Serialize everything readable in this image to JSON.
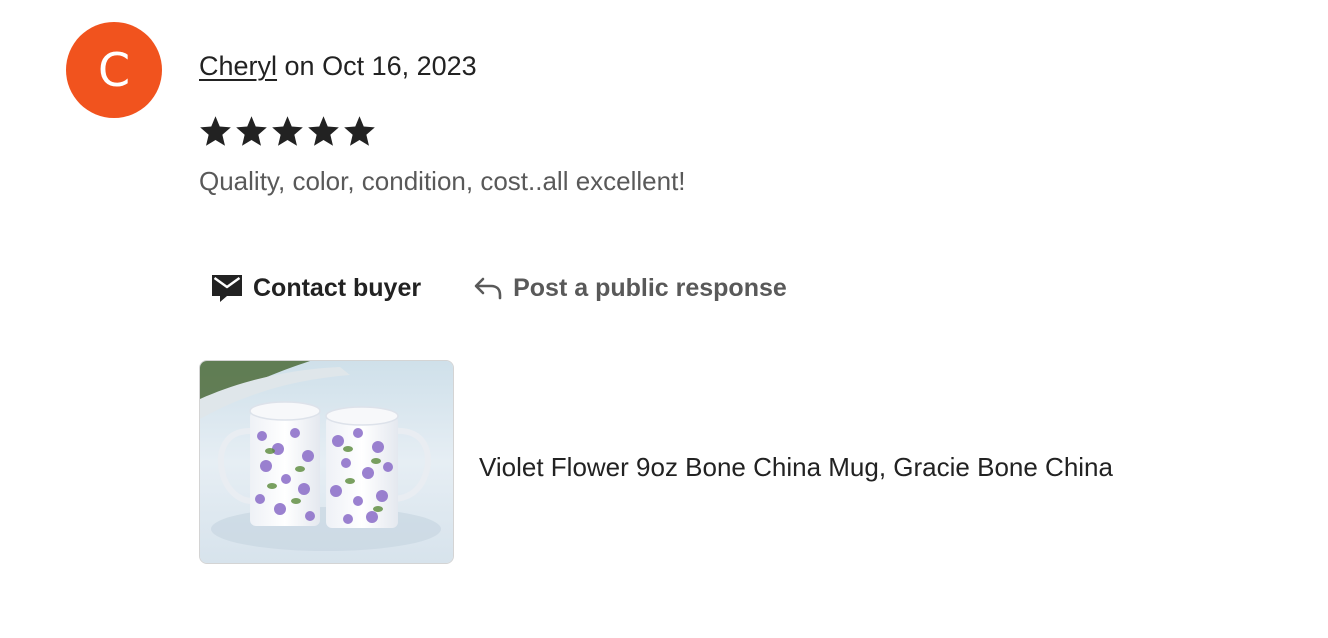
{
  "review": {
    "avatar_letter": "C",
    "reviewer_name": "Cheryl",
    "date_text": " on Oct 16, 2023",
    "rating": 5,
    "rating_max": 5,
    "text": "Quality, color, condition, cost..all excellent!"
  },
  "actions": {
    "contact_label": "Contact buyer",
    "respond_label": "Post a public response"
  },
  "product": {
    "title": "Violet Flower 9oz Bone China Mug, Gracie Bone China",
    "image_alt": "Two violet floral bone china mugs"
  },
  "colors": {
    "avatar_bg": "#f1531e",
    "text_primary": "#222222",
    "text_secondary": "#595959"
  },
  "icons": {
    "contact": "mail-icon",
    "respond": "reply-arrow-icon",
    "rating": "star-icon"
  }
}
